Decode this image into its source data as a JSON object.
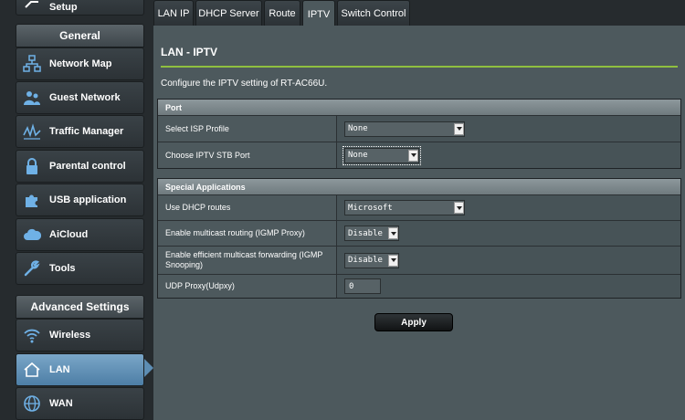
{
  "sidebar": {
    "setup_label": "Setup",
    "general_header": "General",
    "general_items": [
      {
        "label": "Network Map",
        "icon": "network-map-icon"
      },
      {
        "label": "Guest Network",
        "icon": "guest-network-icon"
      },
      {
        "label": "Traffic Manager",
        "icon": "traffic-manager-icon"
      },
      {
        "label": "Parental control",
        "icon": "lock-icon"
      },
      {
        "label": "USB application",
        "icon": "puzzle-icon"
      },
      {
        "label": "AiCloud",
        "icon": "cloud-icon"
      },
      {
        "label": "Tools",
        "icon": "wrench-icon"
      }
    ],
    "advanced_header": "Advanced Settings",
    "advanced_items": [
      {
        "label": "Wireless",
        "icon": "wifi-icon"
      },
      {
        "label": "LAN",
        "icon": "home-icon",
        "active": true
      },
      {
        "label": "WAN",
        "icon": "globe-icon"
      }
    ]
  },
  "tabs": [
    {
      "label": "LAN IP"
    },
    {
      "label": "DHCP Server"
    },
    {
      "label": "Route"
    },
    {
      "label": "IPTV",
      "active": true
    },
    {
      "label": "Switch Control"
    }
  ],
  "page": {
    "title": "LAN - IPTV",
    "description": "Configure the IPTV setting of RT-AC66U."
  },
  "port": {
    "header": "Port",
    "isp_profile_label": "Select ISP Profile",
    "isp_profile_value": "None",
    "stb_port_label": "Choose IPTV STB Port",
    "stb_port_value": "None"
  },
  "special": {
    "header": "Special Applications",
    "dhcp_routes_label": "Use DHCP routes",
    "dhcp_routes_value": "Microsoft",
    "igmp_proxy_label": "Enable multicast routing (IGMP Proxy)",
    "igmp_proxy_value": "Disable",
    "igmp_snooping_label": "Enable efficient multicast forwarding (IGMP Snooping)",
    "igmp_snooping_value": "Disable",
    "udpxy_label": "UDP Proxy(Udpxy)",
    "udpxy_value": "0"
  },
  "apply_label": "Apply",
  "colors": {
    "accent_green": "#8fbf3f",
    "active_blue": "#5d8db3",
    "panel_bg": "#4d595d"
  }
}
